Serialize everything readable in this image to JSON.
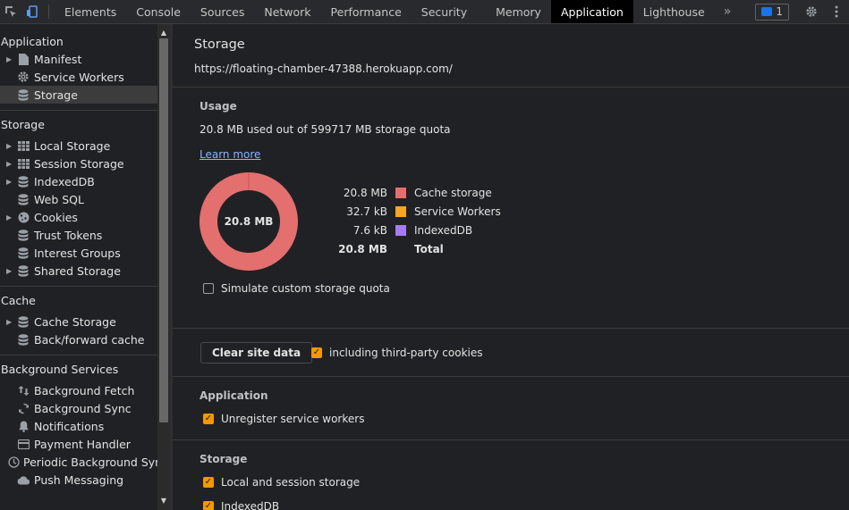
{
  "tabs": [
    "Elements",
    "Console",
    "Sources",
    "Network",
    "Performance",
    "Security",
    "Memory",
    "Application",
    "Lighthouse"
  ],
  "active_tab": "Application",
  "issues_count": "1",
  "sidebar": {
    "sections": [
      {
        "title": "Application",
        "items": [
          {
            "label": "Manifest",
            "icon": "file-icon",
            "expandable": true
          },
          {
            "label": "Service Workers",
            "icon": "gear-icon",
            "expandable": false
          },
          {
            "label": "Storage",
            "icon": "database-icon",
            "expandable": false,
            "selected": true
          }
        ]
      },
      {
        "title": "Storage",
        "items": [
          {
            "label": "Local Storage",
            "icon": "grid-icon",
            "expandable": true
          },
          {
            "label": "Session Storage",
            "icon": "grid-icon",
            "expandable": true
          },
          {
            "label": "IndexedDB",
            "icon": "database-icon",
            "expandable": true
          },
          {
            "label": "Web SQL",
            "icon": "database-icon",
            "expandable": false
          },
          {
            "label": "Cookies",
            "icon": "cookie-icon",
            "expandable": true
          },
          {
            "label": "Trust Tokens",
            "icon": "database-icon",
            "expandable": false
          },
          {
            "label": "Interest Groups",
            "icon": "database-icon",
            "expandable": false
          },
          {
            "label": "Shared Storage",
            "icon": "database-icon",
            "expandable": true
          }
        ]
      },
      {
        "title": "Cache",
        "items": [
          {
            "label": "Cache Storage",
            "icon": "database-icon",
            "expandable": true
          },
          {
            "label": "Back/forward cache",
            "icon": "database-icon",
            "expandable": false
          }
        ]
      },
      {
        "title": "Background Services",
        "items": [
          {
            "label": "Background Fetch",
            "icon": "arrows-updown-icon",
            "expandable": false
          },
          {
            "label": "Background Sync",
            "icon": "sync-icon",
            "expandable": false
          },
          {
            "label": "Notifications",
            "icon": "bell-icon",
            "expandable": false
          },
          {
            "label": "Payment Handler",
            "icon": "card-icon",
            "expandable": false
          },
          {
            "label": "Periodic Background Sync",
            "icon": "clock-icon",
            "expandable": false
          },
          {
            "label": "Push Messaging",
            "icon": "cloud-icon",
            "expandable": false
          }
        ]
      }
    ]
  },
  "main": {
    "title": "Storage",
    "origin": "https://floating-chamber-47388.herokuapp.com/",
    "usage": {
      "heading": "Usage",
      "summary": "20.8 MB used out of 599717 MB storage quota",
      "learn_more": "Learn more",
      "donut_label": "20.8 MB",
      "legend": [
        {
          "value": "20.8 MB",
          "name": "Cache storage",
          "color": "#e46f6f"
        },
        {
          "value": "32.7 kB",
          "name": "Service Workers",
          "color": "#f5a623"
        },
        {
          "value": "7.6 kB",
          "name": "IndexedDB",
          "color": "#a67bf5"
        }
      ],
      "total_value": "20.8 MB",
      "total_label": "Total",
      "simulate_quota": "Simulate custom storage quota"
    },
    "clear": {
      "button": "Clear site data",
      "third_party": "including third-party cookies"
    },
    "application": {
      "heading": "Application",
      "unregister": "Unregister service workers"
    },
    "storage": {
      "heading": "Storage",
      "local_session": "Local and session storage",
      "indexeddb": "IndexedDB"
    }
  }
}
